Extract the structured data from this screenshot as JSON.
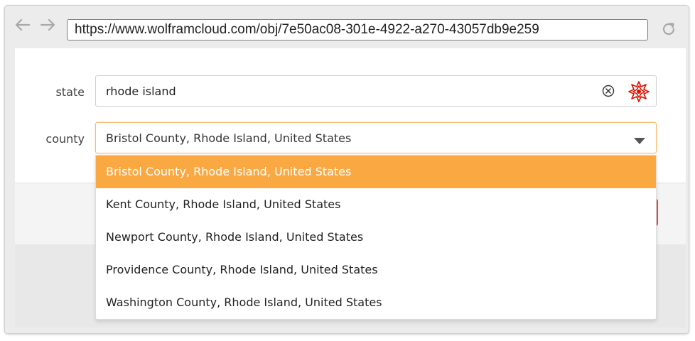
{
  "browser": {
    "url": "https://www.wolframcloud.com/obj/7e50ac08-301e-4922-a270-43057db9e259",
    "back_icon": "arrow-left-icon",
    "forward_icon": "arrow-right-icon",
    "reload_icon": "reload-icon"
  },
  "form": {
    "state": {
      "label": "state",
      "value": "rhode island",
      "clear_icon": "clear-circle-icon",
      "interpreter_icon": "wolfram-spikey-icon"
    },
    "county": {
      "label": "county",
      "selected": "Bristol County, Rhode Island, United States",
      "caret_icon": "chevron-down-icon",
      "options": [
        "Bristol County, Rhode Island, United States",
        "Kent County, Rhode Island, United States",
        "Newport County, Rhode Island, United States",
        "Providence County, Rhode Island, United States",
        "Washington County, Rhode Island, United States"
      ],
      "highlighted_index": 0
    }
  },
  "colors": {
    "highlight": "#faa942",
    "focus_border": "#f5b971",
    "wolfram_red": "#dd1100",
    "submit_edge": "#d9534f"
  }
}
